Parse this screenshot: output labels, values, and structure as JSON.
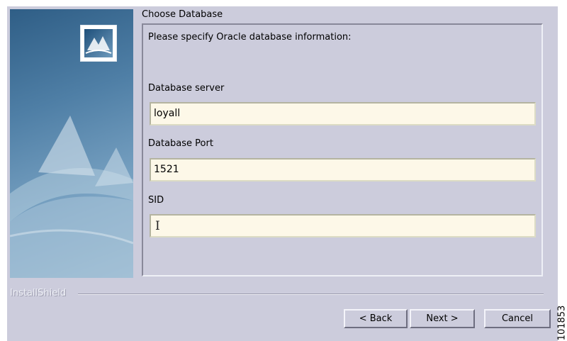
{
  "dialog": {
    "step_title": "Choose Database",
    "prompt": "Please specify Oracle database information:",
    "fields": [
      {
        "label": "Database server",
        "value": "loyall"
      },
      {
        "label": "Database Port",
        "value": "1521"
      },
      {
        "label": "SID",
        "value": ""
      }
    ],
    "brand": "InstallShield",
    "buttons": {
      "back": "< Back",
      "next": "Next >",
      "cancel": "Cancel"
    }
  },
  "figure_id": "101853",
  "colors": {
    "window_bg": "#ccccdc",
    "field_bg": "#fdf8e8",
    "side_panel_dark": "#2f5e86",
    "side_panel_light": "#9bbbd2"
  },
  "icons": {
    "logo": "installer-logo-icon",
    "caret": "text-cursor-icon"
  }
}
